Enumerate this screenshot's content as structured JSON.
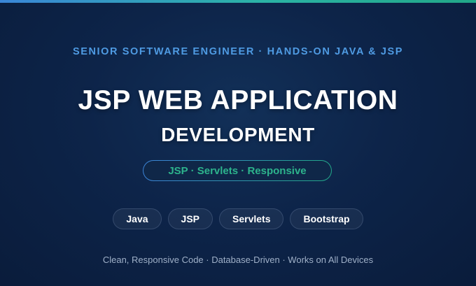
{
  "banner": {
    "eyebrow": "SENIOR SOFTWARE ENGINEER · HANDS-ON JAVA & JSP",
    "title": "JSP WEB APPLICATION",
    "subtitle": "DEVELOPMENT",
    "highlight": "JSP · Servlets · Responsive",
    "tags": [
      "Java",
      "JSP",
      "Servlets",
      "Bootstrap"
    ],
    "features": "Clean, Responsive Code · Database-Driven · Works on All Devices"
  },
  "colors": {
    "background": "#0d2449",
    "accent_blue": "#3a86d8",
    "accent_green": "#22a788",
    "eyebrow_text": "#4f9be3",
    "highlight_text": "#2db38c"
  }
}
